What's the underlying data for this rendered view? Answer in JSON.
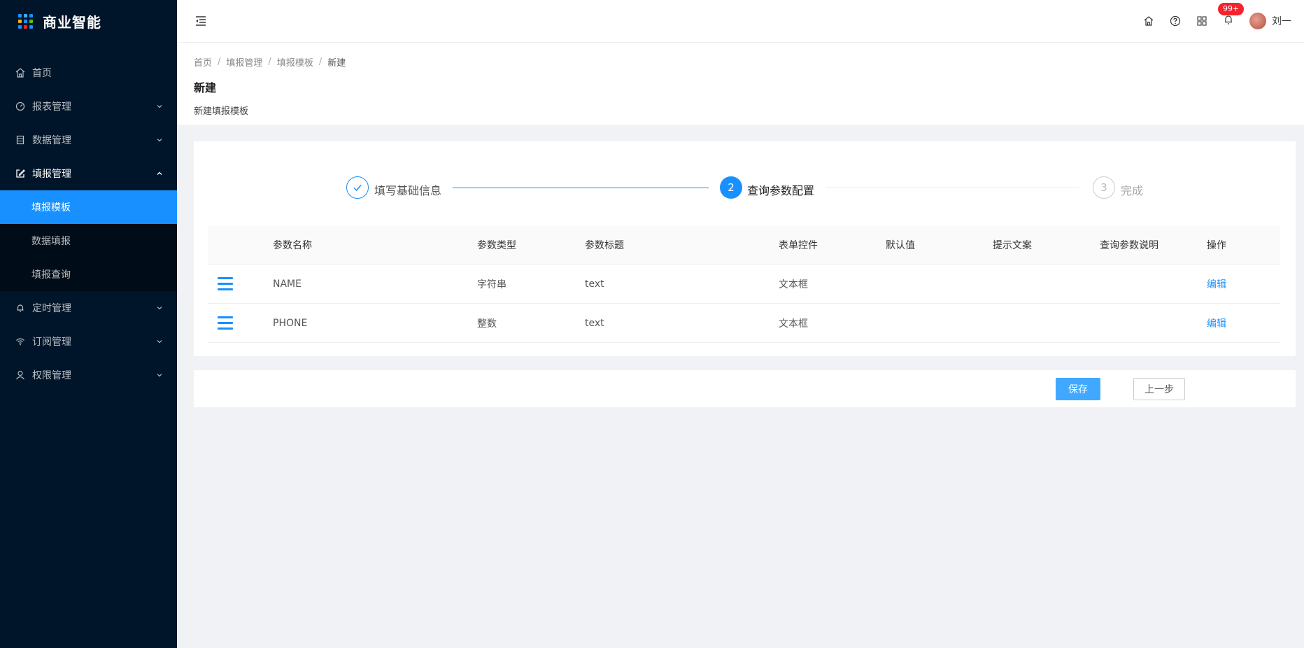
{
  "app": {
    "title": "商业智能"
  },
  "sidebar": {
    "items": [
      {
        "label": "首页",
        "icon": "home-icon"
      },
      {
        "label": "报表管理",
        "icon": "dashboard-icon"
      },
      {
        "label": "数据管理",
        "icon": "database-icon"
      },
      {
        "label": "填报管理",
        "icon": "edit-icon",
        "expanded": true,
        "children": [
          {
            "label": "填报模板",
            "active": true
          },
          {
            "label": "数据填报"
          },
          {
            "label": "填报查询"
          }
        ]
      },
      {
        "label": "定时管理",
        "icon": "bell-icon"
      },
      {
        "label": "订阅管理",
        "icon": "wifi-icon"
      },
      {
        "label": "权限管理",
        "icon": "user-icon"
      }
    ]
  },
  "header": {
    "notification_badge": "99+",
    "user_name": "刘一"
  },
  "breadcrumb": [
    "首页",
    "填报管理",
    "填报模板",
    "新建"
  ],
  "page": {
    "title": "新建",
    "description": "新建填报模板"
  },
  "steps": [
    {
      "label": "填写基础信息",
      "status": "finished"
    },
    {
      "label": "查询参数配置",
      "number": "2",
      "status": "current"
    },
    {
      "label": "完成",
      "number": "3",
      "status": "waiting"
    }
  ],
  "table": {
    "columns": [
      "参数名称",
      "参数类型",
      "参数标题",
      "表单控件",
      "默认值",
      "提示文案",
      "查询参数说明",
      "操作"
    ],
    "rows": [
      {
        "name": "NAME",
        "type": "字符串",
        "title": "text",
        "control": "文本框",
        "default": "",
        "hint": "",
        "desc": "",
        "action": "编辑"
      },
      {
        "name": "PHONE",
        "type": "整数",
        "title": "text",
        "control": "文本框",
        "default": "",
        "hint": "",
        "desc": "",
        "action": "编辑"
      }
    ]
  },
  "buttons": {
    "save": "保存",
    "prev": "上一步"
  },
  "colors": {
    "primary": "#1890ff",
    "sidebar_bg": "#001529",
    "badge": "#f5222d"
  }
}
